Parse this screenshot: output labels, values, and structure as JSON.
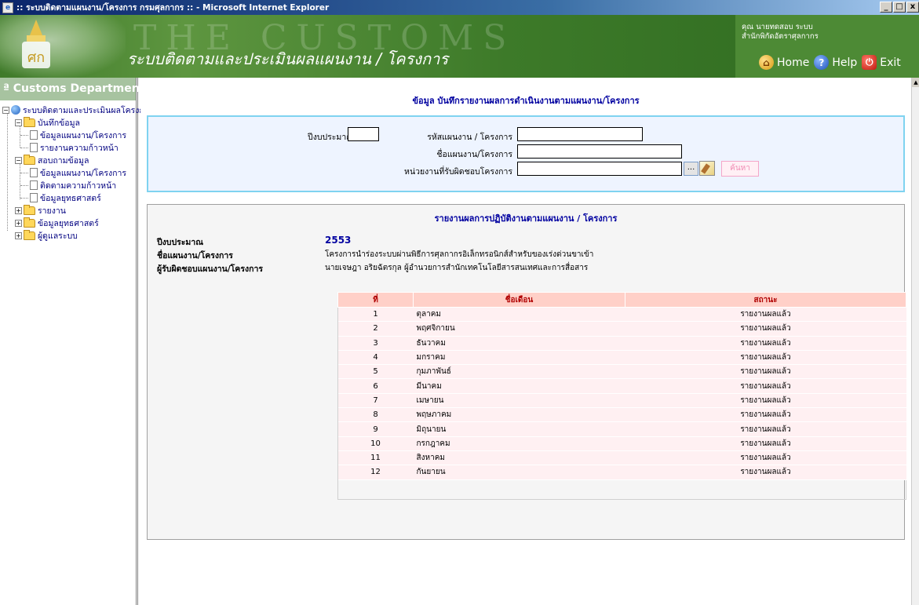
{
  "window": {
    "title": ":: ระบบติดตามแผนงาน/โครงการ กรมศุลกากร :: - Microsoft Internet Explorer",
    "min": "_",
    "max": "□",
    "close": "x"
  },
  "header": {
    "watermark": "THE CUSTOMS",
    "app_title": "ระบบติดตามและประเมินผลแผนงาน / โครงการ",
    "user_line1": "คุณ นายทดสอบ ระบบ",
    "user_line2": "สำนักพิกัดอัตราศุลกากร",
    "nav": {
      "home": "Home",
      "help": "Help",
      "exit": "Exit"
    }
  },
  "sidebar": {
    "dept": "ª Customs Department",
    "root": "ระบบติดตามและประเมินผลโครงการ",
    "nodes": {
      "record": "บันทึกข้อมูล",
      "record_plan": "ข้อมูลแผนงาน/โครงการ",
      "record_progress": "รายงานความก้าวหน้า",
      "query": "สอบถามข้อมูล",
      "query_plan": "ข้อมูลแผนงาน/โครงการ",
      "query_track": "ติดตามความก้าวหน้า",
      "query_strategy": "ข้อมูลยุทธศาสตร์",
      "report": "รายงาน",
      "strategy": "ข้อมูลยุทธศาสตร์",
      "admin": "ผู้ดูแลระบบ"
    }
  },
  "main": {
    "heading": "ข้อมูล  บันทึกรายงานผลการดำเนินงานตามแผนงาน/โครงการ",
    "search": {
      "budget_year_label": "ปีงบประมาณ",
      "budget_year_value": "",
      "project_code_label": "รหัสแผนงาน / โครงการ",
      "project_code_value": "",
      "project_name_label": "ชื่อแผนงาน/โครงการ",
      "project_name_value": "",
      "unit_label": "หน่วยงานที่รับผิดชอบโครงการ",
      "unit_value": "",
      "lookup_label": "...",
      "search_label": "ค้นหา"
    },
    "report": {
      "title": "รายงานผลการปฏิบัติงานตามแผนงาน / โครงการ",
      "year_label": "ปีงบประมาณ",
      "year_value": "2553",
      "name_label": "ชื่อแผนงาน/โครงการ",
      "name_value": "โครงการนำร่องระบบผ่านพิธีการศุลกากรอิเล็กทรอนิกส์สำหรับของเร่งด่วนขาเข้า",
      "owner_label": "ผู้รับผิดชอบแผนงาน/โครงการ",
      "owner_value": "นายเจษฎา อริยฉัตรกุล ผู้อำนวยการสำนักเทคโนโลยีสารสนเทศและการสื่อสาร",
      "columns": [
        "ที่",
        "ชื่อเดือน",
        "สถานะ"
      ],
      "rows": [
        [
          "1",
          "ตุลาคม",
          "รายงานผลแล้ว"
        ],
        [
          "2",
          "พฤศจิกายน",
          "รายงานผลแล้ว"
        ],
        [
          "3",
          "ธันวาคม",
          "รายงานผลแล้ว"
        ],
        [
          "4",
          "มกราคม",
          "รายงานผลแล้ว"
        ],
        [
          "5",
          "กุมภาพันธ์",
          "รายงานผลแล้ว"
        ],
        [
          "6",
          "มีนาคม",
          "รายงานผลแล้ว"
        ],
        [
          "7",
          "เมษายน",
          "รายงานผลแล้ว"
        ],
        [
          "8",
          "พฤษภาคม",
          "รายงานผลแล้ว"
        ],
        [
          "9",
          "มิถุนายน",
          "รายงานผลแล้ว"
        ],
        [
          "10",
          "กรกฎาคม",
          "รายงานผลแล้ว"
        ],
        [
          "11",
          "สิงหาคม",
          "รายงานผลแล้ว"
        ],
        [
          "12",
          "กันยายน",
          "รายงานผลแล้ว"
        ]
      ]
    }
  }
}
